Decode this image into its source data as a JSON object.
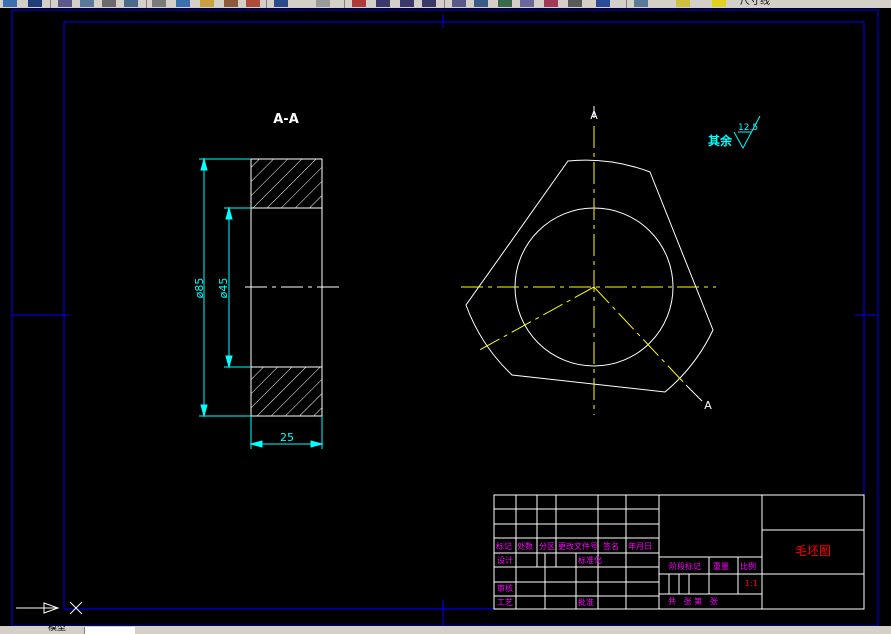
{
  "app": {
    "toolbar_layer_name": "尺寸线",
    "status_tab_model": "模型"
  },
  "drawing": {
    "section_view_label": "A-A",
    "section_marker_top": "A",
    "section_marker_bottom": "A",
    "surface_finish_prefix": "其余",
    "surface_finish_value": "12.5",
    "dimensions": {
      "outer_diameter": "ø85",
      "inner_diameter": "ø45",
      "width": "25"
    }
  },
  "title_block": {
    "drawing_title": "毛坯图",
    "row_labels_left": {
      "mark": "标记",
      "count": "处数",
      "zone": "分区",
      "change_doc_no": "更改文件号",
      "signature": "签名",
      "date": "年月日"
    },
    "roles": {
      "design": "设计",
      "standardize": "标准化",
      "review": "审核",
      "process": "工艺",
      "approve": "批准"
    },
    "stage_mark": "阶段标记",
    "weight": "重量",
    "scale": "比例",
    "scale_value": "1:1",
    "sheet_info": "共   张 第   张"
  },
  "colors": {
    "background": "#000000",
    "geometry": "#ffffff",
    "dimension": "#00ffff",
    "centerline": "#ffff00",
    "frame": "#0000ff",
    "title_text": "#ff0000",
    "table_text": "#ff00ff"
  }
}
